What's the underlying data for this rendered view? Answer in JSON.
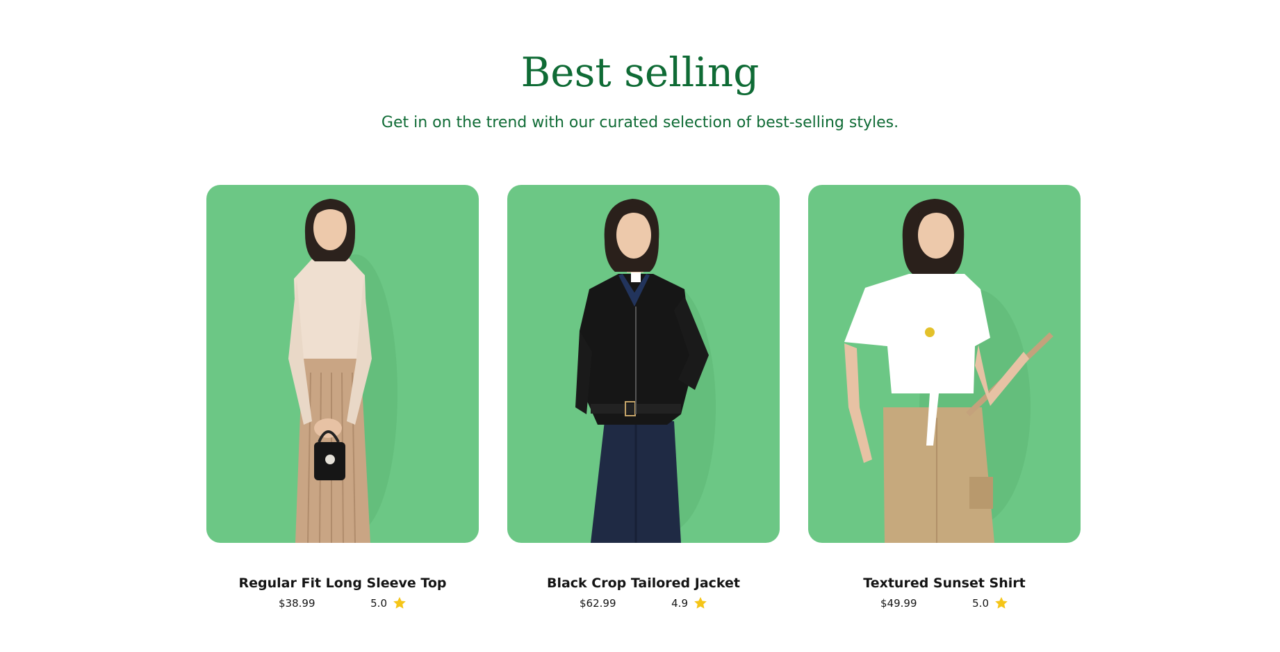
{
  "section": {
    "title": "Best selling",
    "subtitle": "Get in on the trend with our curated selection of best-selling styles."
  },
  "colors": {
    "accent": "#0f6b35",
    "card_bg": "#6cc785",
    "star": "#f5c518"
  },
  "products": [
    {
      "name": "Regular Fit Long Sleeve Top",
      "price": "$38.99",
      "rating": "5.0",
      "icon": "star-icon"
    },
    {
      "name": "Black Crop Tailored Jacket",
      "price": "$62.99",
      "rating": "4.9",
      "icon": "star-icon"
    },
    {
      "name": "Textured Sunset Shirt",
      "price": "$49.99",
      "rating": "5.0",
      "icon": "star-icon"
    }
  ]
}
